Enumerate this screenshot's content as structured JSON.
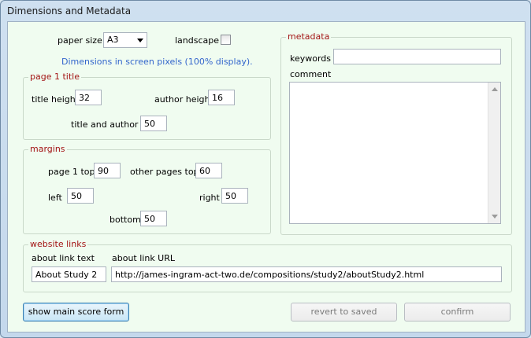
{
  "window": {
    "title": "Dimensions and Metadata"
  },
  "paper": {
    "paper_size_label": "paper size",
    "paper_size_value": "A3",
    "landscape_label": "landscape",
    "landscape_checked": false,
    "info_text": "Dimensions in screen pixels (100% display)."
  },
  "page1_title": {
    "legend": "page 1 title",
    "title_height_label": "title height",
    "title_height_value": "32",
    "author_height_label": "author height",
    "author_height_value": "16",
    "title_author_y_label": "title and author Y",
    "title_author_y_value": "50"
  },
  "margins": {
    "legend": "margins",
    "page1_top_label": "page 1 top",
    "page1_top_value": "90",
    "other_pages_top_label": "other pages top",
    "other_pages_top_value": "60",
    "left_label": "left",
    "left_value": "50",
    "right_label": "right",
    "right_value": "50",
    "bottom_label": "bottom",
    "bottom_value": "50"
  },
  "metadata": {
    "legend": "metadata",
    "keywords_label": "keywords",
    "keywords_value": "",
    "comment_label": "comment",
    "comment_value": ""
  },
  "website_links": {
    "legend": "website links",
    "about_link_text_label": "about link text",
    "about_link_text_value": "About Study 2",
    "about_link_url_label": "about link URL",
    "about_link_url_value": "http://james-ingram-act-two.de/compositions/study2/aboutStudy2.html"
  },
  "buttons": {
    "show_main_score_form": "show main score form",
    "revert_to_saved": "revert to saved",
    "confirm": "confirm"
  }
}
